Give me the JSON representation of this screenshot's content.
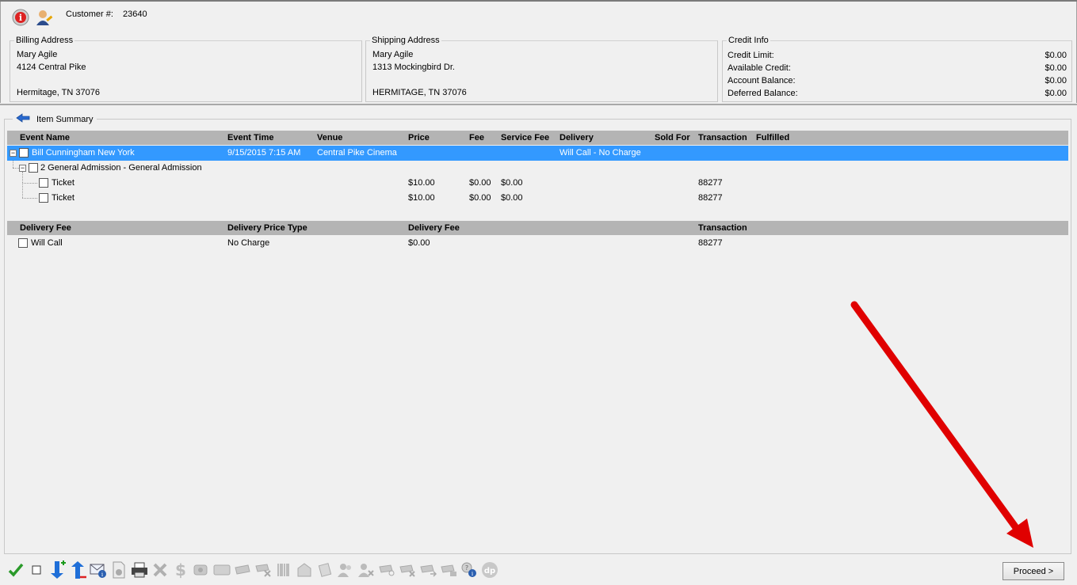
{
  "customer": {
    "label": "Customer #:",
    "number": "23640"
  },
  "billing": {
    "legend": "Billing Address",
    "name": "Mary Agile",
    "street": "4124 Central Pike",
    "city": "Hermitage, TN 37076"
  },
  "shipping": {
    "legend": "Shipping Address",
    "name": "Mary Agile",
    "street": "1313 Mockingbird Dr.",
    "city": "HERMITAGE, TN 37076"
  },
  "credit": {
    "legend": "Credit Info",
    "rows": [
      {
        "label": "Credit Limit:",
        "value": "$0.00"
      },
      {
        "label": "Available Credit:",
        "value": "$0.00"
      },
      {
        "label": "Account Balance:",
        "value": "$0.00"
      },
      {
        "label": "Deferred Balance:",
        "value": "$0.00"
      }
    ]
  },
  "summary": {
    "title": "Item Summary"
  },
  "items_grid": {
    "headers": {
      "event_name": "Event Name",
      "event_time": "Event Time",
      "venue": "Venue",
      "price": "Price",
      "fee": "Fee",
      "service_fee": "Service Fee",
      "delivery": "Delivery",
      "sold_for": "Sold For",
      "transaction": "Transaction",
      "fulfilled": "Fulfilled"
    },
    "event": {
      "name": "Bill Cunningham New York",
      "time": "9/15/2015 7:15 AM",
      "venue": "Central Pike Cinema",
      "delivery": "Will Call  - No Charge"
    },
    "group": {
      "name": "2 General Admission - General Admission"
    },
    "tickets": [
      {
        "name": "Ticket",
        "price": "$10.00",
        "fee": "$0.00",
        "service_fee": "$0.00",
        "transaction": "88277"
      },
      {
        "name": "Ticket",
        "price": "$10.00",
        "fee": "$0.00",
        "service_fee": "$0.00",
        "transaction": "88277"
      }
    ]
  },
  "delivery_grid": {
    "headers": {
      "delivery_fee": "Delivery Fee",
      "price_type": "Delivery Price Type",
      "delivery_fee_amount": "Delivery Fee",
      "transaction": "Transaction"
    },
    "row": {
      "name": "Will Call",
      "price_type": "No Charge",
      "fee": "$0.00",
      "transaction": "88277"
    }
  },
  "proceed_label": "Proceed >",
  "colors": {
    "selection": "#3399ff",
    "header_bg": "#b4b4b4",
    "annotation_arrow": "#e00000"
  }
}
